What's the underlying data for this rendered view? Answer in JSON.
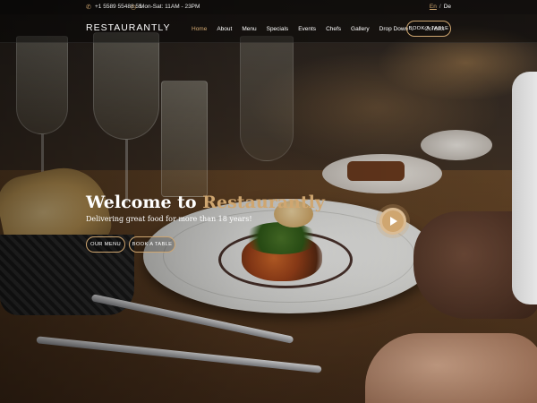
{
  "topbar": {
    "phone_icon": "phone-icon",
    "phone": "+1 5589 55488 55",
    "hours_icon": "clock-icon",
    "hours": "Mon-Sat: 11AM - 23PM",
    "languages": [
      "En",
      "De"
    ],
    "language_separator": "/",
    "active_language": "En"
  },
  "navbar": {
    "logo": "RESTAURANTLY",
    "menu": [
      {
        "label": "Home",
        "active": true
      },
      {
        "label": "About"
      },
      {
        "label": "Menu"
      },
      {
        "label": "Specials"
      },
      {
        "label": "Events"
      },
      {
        "label": "Chefs"
      },
      {
        "label": "Gallery"
      },
      {
        "label": "Drop Down",
        "dropdown": true
      },
      {
        "label": "Contact"
      }
    ],
    "dropdown_icon": "chevron-down-icon",
    "book_button": "BOOK A TABLE"
  },
  "hero": {
    "title_prefix": "Welcome to ",
    "title_brand": "Restaurantly",
    "subtitle": "Delivering great food for more than 18 years!",
    "buttons": {
      "menu": "OUR MENU",
      "book": "BOOK A TABLE"
    },
    "play_icon": "play-icon"
  },
  "colors": {
    "accent": "#cfa670",
    "text": "#ffffff",
    "overlay": "#000000"
  }
}
